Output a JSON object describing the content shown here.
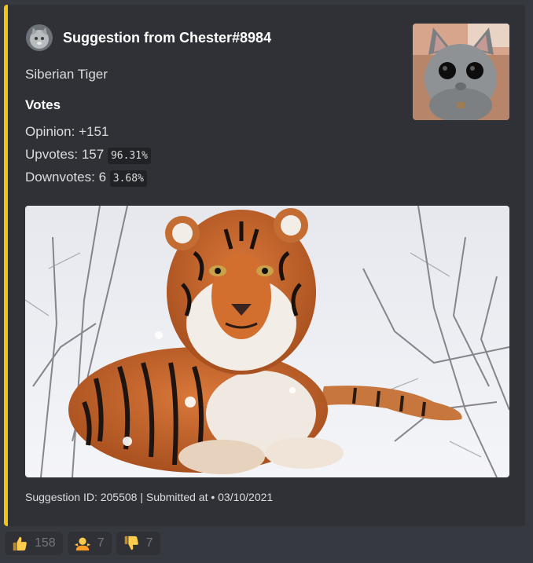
{
  "embed": {
    "accent_color": "#f1c40f",
    "author": {
      "name": "Suggestion from Chester#8984",
      "avatar_icon": "cat-avatar"
    },
    "thumbnail_icon": "gray-cat-with-sunglasses",
    "description": "Siberian Tiger",
    "field": {
      "name": "Votes",
      "opinion_label": "Opinion:",
      "opinion_value": "+151",
      "upvotes_label": "Upvotes:",
      "upvotes_count": "157",
      "upvotes_percent": "96.31%",
      "downvotes_label": "Downvotes:",
      "downvotes_count": "6",
      "downvotes_percent": "3.68%"
    },
    "image_icon": "siberian-tiger-in-snow",
    "footer": "Suggestion ID: 205508 | Submitted at • 03/10/2021"
  },
  "reactions": [
    {
      "icon": "thumbs-up-icon",
      "count": "158"
    },
    {
      "icon": "person-shrugging-icon",
      "count": "7"
    },
    {
      "icon": "thumbs-down-icon",
      "count": "7"
    }
  ]
}
